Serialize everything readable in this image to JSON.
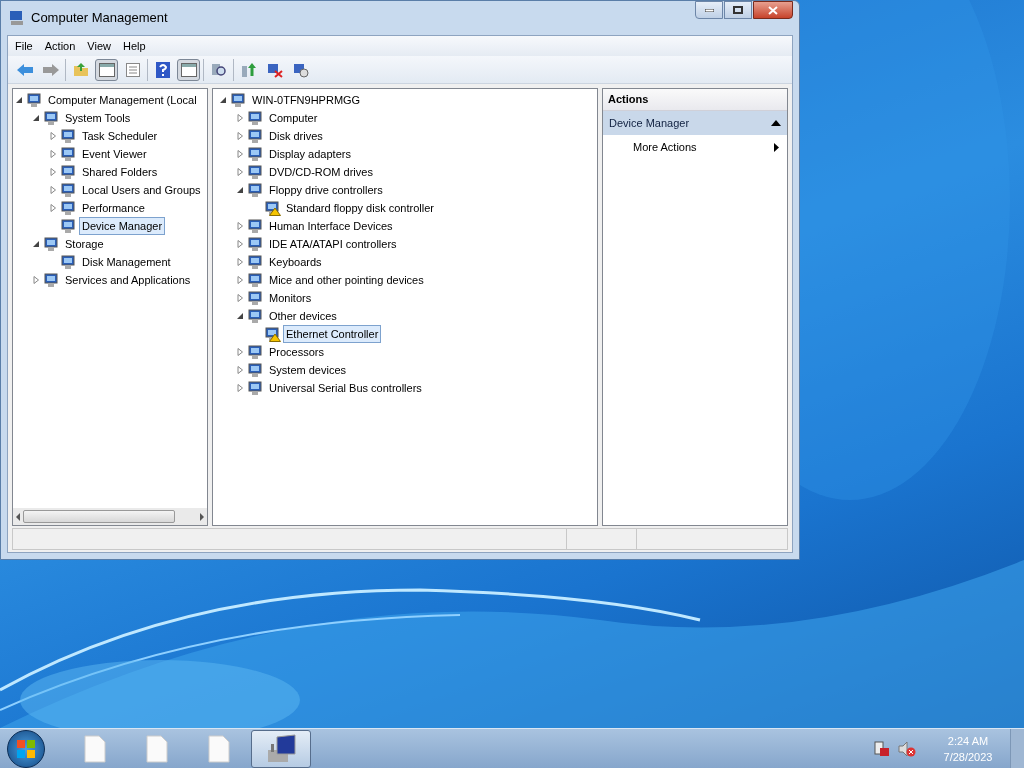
{
  "window": {
    "title": "Computer Management"
  },
  "menu": [
    "File",
    "Action",
    "View",
    "Help"
  ],
  "toolbar": [
    [
      {
        "kind": "back",
        "pressed": false
      },
      {
        "kind": "forward",
        "pressed": false
      }
    ],
    [
      {
        "kind": "up",
        "pressed": false
      },
      {
        "kind": "pane",
        "pressed": true
      },
      {
        "kind": "list",
        "pressed": false
      }
    ],
    [
      {
        "kind": "help",
        "pressed": false
      },
      {
        "kind": "pane",
        "pressed": true
      }
    ],
    [
      {
        "kind": "scan",
        "pressed": false
      }
    ],
    [
      {
        "kind": "update",
        "pressed": false
      },
      {
        "kind": "remove",
        "pressed": false
      },
      {
        "kind": "install",
        "pressed": false
      }
    ]
  ],
  "console_tree": [
    {
      "label": "Computer Management (Local",
      "kind": "branch",
      "expanded": true,
      "selected": false,
      "children": [
        {
          "label": "System Tools",
          "kind": "branch",
          "expanded": true,
          "selected": false,
          "children": [
            {
              "label": "Task Scheduler",
              "kind": "branch",
              "expanded": false,
              "selected": false
            },
            {
              "label": "Event Viewer",
              "kind": "branch",
              "expanded": false,
              "selected": false
            },
            {
              "label": "Shared Folders",
              "kind": "branch",
              "expanded": false,
              "selected": false
            },
            {
              "label": "Local Users and Groups",
              "kind": "branch",
              "expanded": false,
              "selected": false
            },
            {
              "label": "Performance",
              "kind": "branch",
              "expanded": false,
              "selected": false
            },
            {
              "label": "Device Manager",
              "kind": "leaf",
              "selected": true
            }
          ]
        },
        {
          "label": "Storage",
          "kind": "branch",
          "expanded": true,
          "selected": false,
          "children": [
            {
              "label": "Disk Management",
              "kind": "leaf",
              "selected": false
            }
          ]
        },
        {
          "label": "Services and Applications",
          "kind": "branch",
          "expanded": false,
          "selected": false
        }
      ]
    }
  ],
  "device_tree": [
    {
      "label": "WIN-0TFN9HPRMGG",
      "kind": "branch",
      "expanded": true,
      "selected": false,
      "warning": false,
      "children": [
        {
          "label": "Computer",
          "kind": "branch",
          "expanded": false,
          "selected": false,
          "warning": false
        },
        {
          "label": "Disk drives",
          "kind": "branch",
          "expanded": false,
          "selected": false,
          "warning": false
        },
        {
          "label": "Display adapters",
          "kind": "branch",
          "expanded": false,
          "selected": false,
          "warning": false
        },
        {
          "label": "DVD/CD-ROM drives",
          "kind": "branch",
          "expanded": false,
          "selected": false,
          "warning": false
        },
        {
          "label": "Floppy drive controllers",
          "kind": "branch",
          "expanded": true,
          "selected": false,
          "warning": false,
          "children": [
            {
              "label": "Standard floppy disk controller",
              "kind": "leaf",
              "selected": false,
              "warning": true
            }
          ]
        },
        {
          "label": "Human Interface Devices",
          "kind": "branch",
          "expanded": false,
          "selected": false,
          "warning": false
        },
        {
          "label": "IDE ATA/ATAPI controllers",
          "kind": "branch",
          "expanded": false,
          "selected": false,
          "warning": false
        },
        {
          "label": "Keyboards",
          "kind": "branch",
          "expanded": false,
          "selected": false,
          "warning": false
        },
        {
          "label": "Mice and other pointing devices",
          "kind": "branch",
          "expanded": false,
          "selected": false,
          "warning": false
        },
        {
          "label": "Monitors",
          "kind": "branch",
          "expanded": false,
          "selected": false,
          "warning": false
        },
        {
          "label": "Other devices",
          "kind": "branch",
          "expanded": true,
          "selected": false,
          "warning": false,
          "children": [
            {
              "label": "Ethernet Controller",
              "kind": "leaf",
              "selected": true,
              "warning": true
            }
          ]
        },
        {
          "label": "Processors",
          "kind": "branch",
          "expanded": false,
          "selected": false,
          "warning": false
        },
        {
          "label": "System devices",
          "kind": "branch",
          "expanded": false,
          "selected": false,
          "warning": false
        },
        {
          "label": "Universal Serial Bus controllers",
          "kind": "branch",
          "expanded": false,
          "selected": false,
          "warning": false
        }
      ]
    }
  ],
  "actions": {
    "title": "Actions",
    "section": {
      "label": "Device Manager",
      "expanded": true
    },
    "items": [
      "More Actions"
    ]
  },
  "taskbar": {
    "items": [
      {
        "kind": "file",
        "selected": false
      },
      {
        "kind": "file",
        "selected": false
      },
      {
        "kind": "file",
        "selected": false
      },
      {
        "kind": "app",
        "selected": true
      }
    ],
    "time": "2:24 AM",
    "date": "7/28/2023"
  }
}
